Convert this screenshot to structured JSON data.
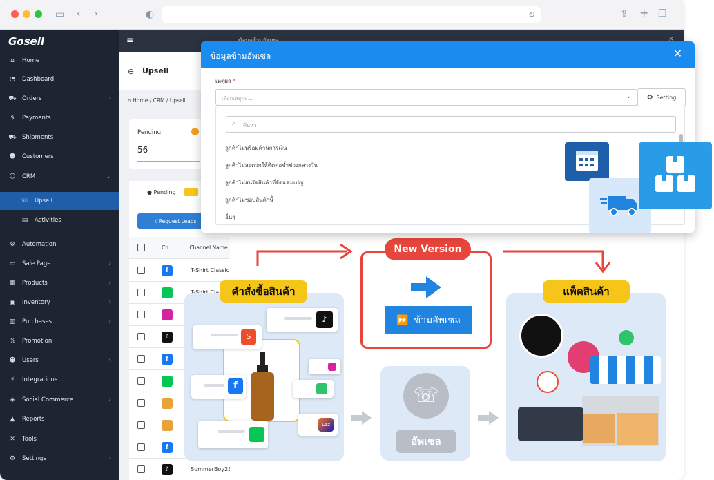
{
  "sidebar": {
    "logo": "Gosell",
    "items": [
      {
        "label": "Home",
        "icon": "home-icon",
        "glyph": "⌂",
        "chev": ""
      },
      {
        "label": "Dashboard",
        "icon": "dashboard-icon",
        "glyph": "◔",
        "chev": ""
      },
      {
        "label": "Orders",
        "icon": "cart-icon",
        "glyph": "⛟",
        "chev": "›"
      },
      {
        "label": "Payments",
        "icon": "payments-icon",
        "glyph": "$",
        "chev": ""
      },
      {
        "label": "Shipments",
        "icon": "truck-icon",
        "glyph": "⛟",
        "chev": ""
      },
      {
        "label": "Customers",
        "icon": "customers-icon",
        "glyph": "☻",
        "chev": ""
      },
      {
        "label": "CRM",
        "icon": "crm-icon",
        "glyph": "☺",
        "chev": "⌄"
      },
      {
        "label": "Upsell",
        "icon": "phone-icon",
        "glyph": "☏",
        "chev": ""
      },
      {
        "label": "Activities",
        "icon": "activities-icon",
        "glyph": "▤",
        "chev": ""
      },
      {
        "label": "Automation",
        "icon": "automation-icon",
        "glyph": "⚙",
        "chev": ""
      },
      {
        "label": "Sale Page",
        "icon": "salepage-icon",
        "glyph": "▭",
        "chev": "›"
      },
      {
        "label": "Products",
        "icon": "products-icon",
        "glyph": "▦",
        "chev": "›"
      },
      {
        "label": "Inventory",
        "icon": "inventory-icon",
        "glyph": "▣",
        "chev": "›"
      },
      {
        "label": "Purchases",
        "icon": "purchases-icon",
        "glyph": "▥",
        "chev": "›"
      },
      {
        "label": "Promotion",
        "icon": "promotion-icon",
        "glyph": "%",
        "chev": ""
      },
      {
        "label": "Users",
        "icon": "users-icon",
        "glyph": "☻",
        "chev": "›"
      },
      {
        "label": "Integrations",
        "icon": "integrations-icon",
        "glyph": "⚡",
        "chev": ""
      },
      {
        "label": "Social Commerce",
        "icon": "social-icon",
        "glyph": "◈",
        "chev": "›"
      },
      {
        "label": "Reports",
        "icon": "reports-icon",
        "glyph": "▲",
        "chev": ""
      },
      {
        "label": "Tools",
        "icon": "tools-icon",
        "glyph": "✕",
        "chev": ""
      },
      {
        "label": "Settings",
        "icon": "settings-icon",
        "glyph": "⚙",
        "chev": "›"
      }
    ]
  },
  "main": {
    "page_title": "Upsell",
    "breadcrumb": "Home  /  CRM  /  Upsell",
    "pending_label": "Pending",
    "pending_count": "56",
    "tab_pending": "Pending",
    "request_leads": "Request Leads",
    "col_ch": "Ch.",
    "col_channel_name": "Channel Name",
    "rows": [
      {
        "channel": "facebook",
        "name": "T-Shirt Classic"
      },
      {
        "channel": "line",
        "name": "T-Shirt Cla"
      },
      {
        "channel": "instagram",
        "name": ""
      },
      {
        "channel": "tiktok",
        "name": ""
      },
      {
        "channel": "facebook",
        "name": ""
      },
      {
        "channel": "line",
        "name": ""
      },
      {
        "channel": "other",
        "name": ""
      },
      {
        "channel": "other",
        "name": ""
      },
      {
        "channel": "facebook",
        "name": ""
      },
      {
        "channel": "tiktok",
        "name": "SummerBoy23"
      }
    ]
  },
  "overlay": {
    "title": "ข้อมูลข้ามอัพเซล"
  },
  "modal": {
    "title": "ข้อมูลข้ามอัพเซล",
    "reason_label": "เหตุผล",
    "required_mark": "*",
    "select_placeholder": "เลือกเหตุผล...",
    "setting_button": "Setting",
    "search_placeholder": "ค้นหา",
    "options": [
      "ลูกค้าไม่พร้อมด้านการเงิน",
      "ลูกค้าไม่สะดวกให้ติดต่อซ้ำช่วงกลางวัน",
      "ลูกค้าไม่สนใจสินค้าที่จัดแคมเปญ",
      "ลูกค้าไม่ชอบสินค้านี้",
      "อื่นๆ"
    ]
  },
  "promo": {
    "new_version": "New Version",
    "orders_label": "คำสั่งซื้อสินค้า",
    "skip_upsell": "ข้ามอัพเซล",
    "pack_label": "แพ็คสินค้า",
    "upsell_label": "อัพเซล"
  },
  "colors": {
    "sidebar_bg": "#1e2532",
    "active_nav": "#1f5fa9",
    "modal_header": "#1a8cf0",
    "accent_red": "#e8453c",
    "accent_yellow": "#f5c518",
    "skip_blue": "#2184e0"
  }
}
